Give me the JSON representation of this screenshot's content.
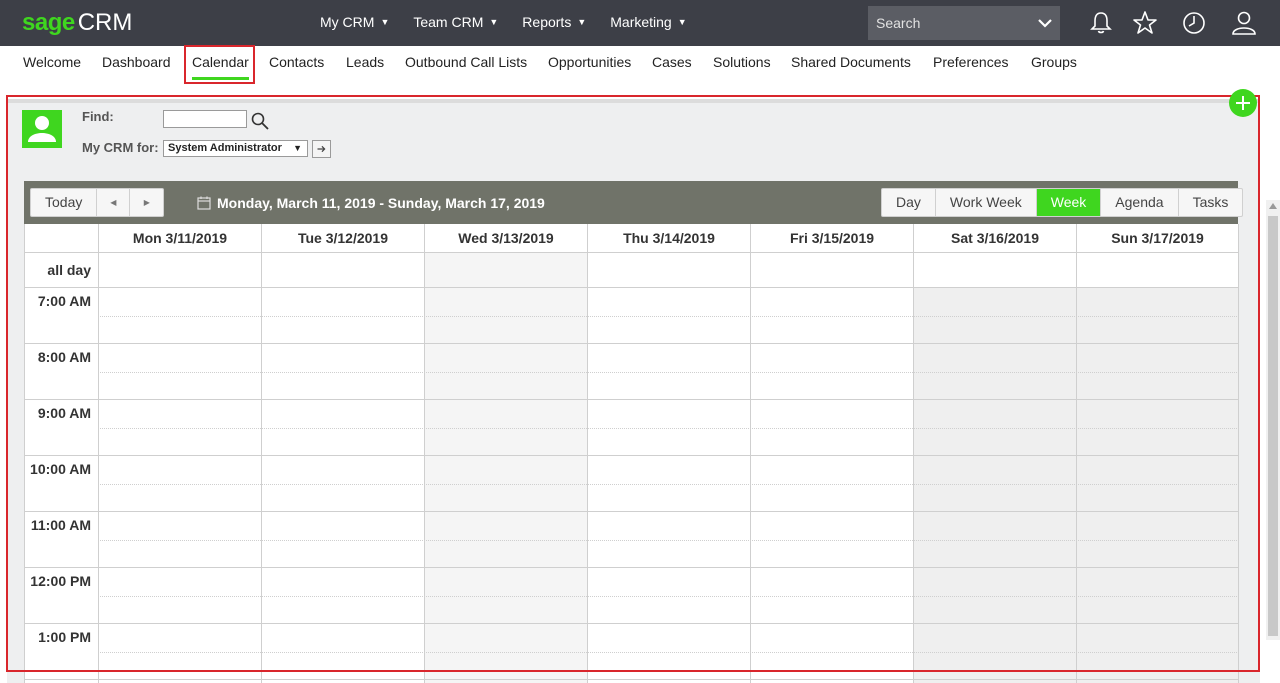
{
  "brand": {
    "logo_sage": "sage",
    "logo_crm": "CRM",
    "accent": "#3fd61f",
    "topbar_bg": "#3d3f47"
  },
  "topnav": [
    {
      "label": "My CRM"
    },
    {
      "label": "Team CRM"
    },
    {
      "label": "Reports"
    },
    {
      "label": "Marketing"
    }
  ],
  "search": {
    "placeholder": "Search"
  },
  "topicons": [
    "bell-icon",
    "star-icon",
    "clock-icon",
    "user-icon"
  ],
  "tabs": [
    {
      "label": "Welcome"
    },
    {
      "label": "Dashboard"
    },
    {
      "label": "Calendar",
      "active": true
    },
    {
      "label": "Contacts"
    },
    {
      "label": "Leads"
    },
    {
      "label": "Outbound Call Lists"
    },
    {
      "label": "Opportunities"
    },
    {
      "label": "Cases"
    },
    {
      "label": "Solutions"
    },
    {
      "label": "Shared Documents"
    },
    {
      "label": "Preferences"
    },
    {
      "label": "Groups"
    }
  ],
  "filters": {
    "find_label": "Find:",
    "find_value": "",
    "mycrm_label": "My CRM for:",
    "mycrm_value": "System Administrator"
  },
  "toolbar": {
    "today": "Today",
    "prev": "◀",
    "next": "▶",
    "date_range": "Monday, March 11, 2019 - Sunday, March 17, 2019",
    "views": [
      {
        "label": "Day"
      },
      {
        "label": "Work Week"
      },
      {
        "label": "Week",
        "active": true
      },
      {
        "label": "Agenda"
      },
      {
        "label": "Tasks"
      }
    ]
  },
  "calendar": {
    "days": [
      "Mon 3/11/2019",
      "Tue 3/12/2019",
      "Wed 3/13/2019",
      "Thu 3/14/2019",
      "Fri 3/15/2019",
      "Sat 3/16/2019",
      "Sun 3/17/2019"
    ],
    "all_day_label": "all day",
    "times": [
      "7:00 AM",
      "8:00 AM",
      "9:00 AM",
      "10:00 AM",
      "11:00 AM",
      "12:00 PM",
      "1:00 PM"
    ]
  }
}
